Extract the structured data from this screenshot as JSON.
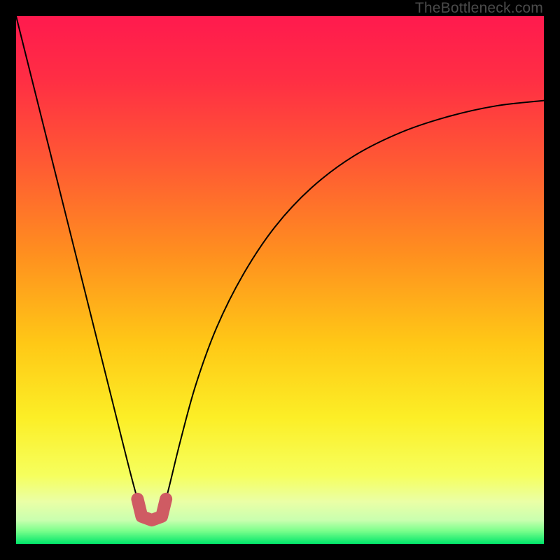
{
  "watermark": "TheBottleneck.com",
  "gradient": {
    "stops": [
      {
        "offset": 0.0,
        "color": "#ff1a4e"
      },
      {
        "offset": 0.12,
        "color": "#ff2e44"
      },
      {
        "offset": 0.28,
        "color": "#ff5a33"
      },
      {
        "offset": 0.45,
        "color": "#ff8f1f"
      },
      {
        "offset": 0.62,
        "color": "#ffc816"
      },
      {
        "offset": 0.76,
        "color": "#fcee26"
      },
      {
        "offset": 0.87,
        "color": "#f6ff5d"
      },
      {
        "offset": 0.92,
        "color": "#eaffa6"
      },
      {
        "offset": 0.955,
        "color": "#c9ffaf"
      },
      {
        "offset": 0.975,
        "color": "#7dff8c"
      },
      {
        "offset": 1.0,
        "color": "#00e66a"
      }
    ]
  },
  "marker": {
    "color": "#cf5b63",
    "stroke_width": 18,
    "points": [
      {
        "x": 0.23,
        "y": 0.915
      },
      {
        "x": 0.238,
        "y": 0.948
      },
      {
        "x": 0.257,
        "y": 0.955
      },
      {
        "x": 0.276,
        "y": 0.948
      },
      {
        "x": 0.284,
        "y": 0.915
      }
    ]
  },
  "chart_data": {
    "type": "line",
    "title": "",
    "xlabel": "",
    "ylabel": "",
    "xlim": [
      0,
      1
    ],
    "ylim": [
      0,
      1
    ],
    "note": "x and y are normalized to the plot area (0..1). y increases downward as drawn; the dip approaches the bottom edge (good/green zone).",
    "series": [
      {
        "name": "bottleneck-curve",
        "x": [
          0.0,
          0.03,
          0.06,
          0.09,
          0.12,
          0.15,
          0.18,
          0.21,
          0.23,
          0.245,
          0.257,
          0.269,
          0.284,
          0.31,
          0.34,
          0.38,
          0.43,
          0.49,
          0.56,
          0.64,
          0.73,
          0.82,
          0.91,
          1.0
        ],
        "y": [
          0.0,
          0.12,
          0.24,
          0.36,
          0.48,
          0.6,
          0.72,
          0.84,
          0.915,
          0.955,
          0.965,
          0.955,
          0.915,
          0.81,
          0.7,
          0.59,
          0.49,
          0.4,
          0.325,
          0.265,
          0.22,
          0.19,
          0.17,
          0.16
        ]
      }
    ],
    "marker_region": {
      "name": "optimal-zone",
      "x_range": [
        0.23,
        0.284
      ],
      "y_approx": 0.94
    }
  }
}
